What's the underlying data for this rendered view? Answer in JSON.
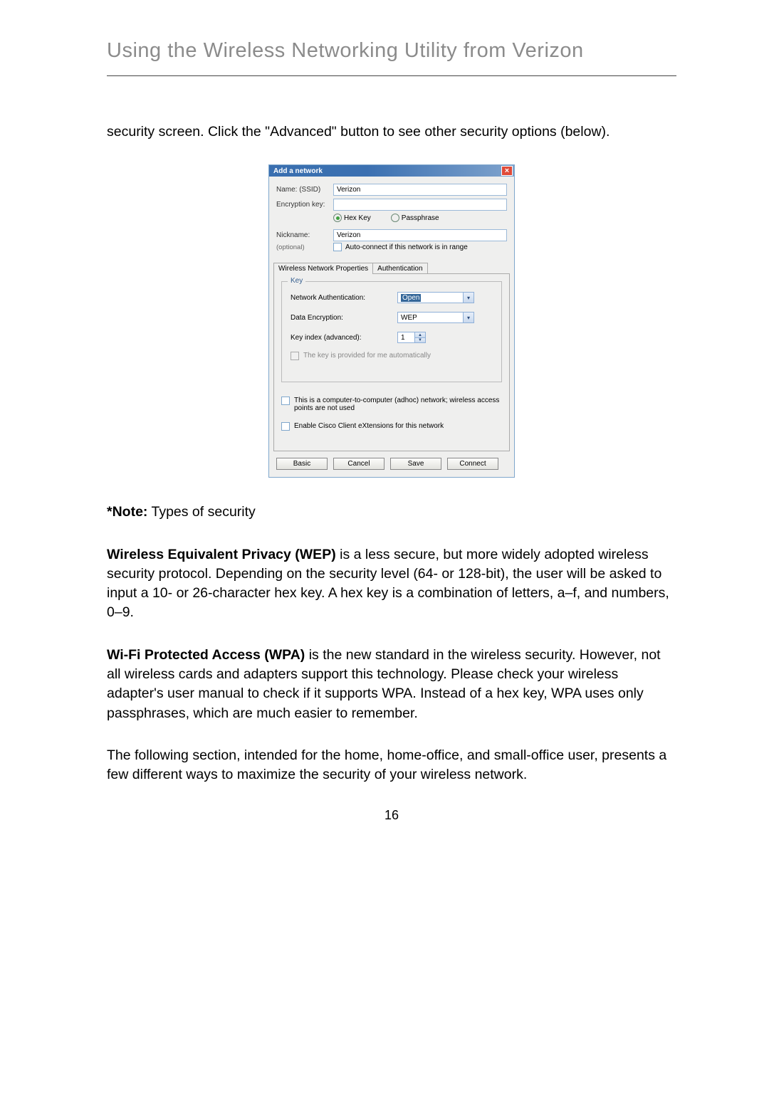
{
  "page": {
    "title": "Using the Wireless Networking Utility from Verizon",
    "intro": "security screen. Click the \"Advanced\" button to see other security options (below).",
    "note_label": "*Note:",
    "note_text": " Types of security",
    "wep": {
      "title": "Wireless Equivalent Privacy (WEP)",
      "text": " is a less secure, but more widely adopted wireless security protocol. Depending on the security level (64- or 128-bit), the user will be asked to input a 10- or 26-character hex key. A hex key is a combination of letters, a–f, and numbers, 0–9."
    },
    "wpa": {
      "title": "Wi-Fi Protected Access (WPA)",
      "text": " is the new standard in the wireless security. However, not all wireless cards and adapters support this technology. Please check your wireless adapter's user manual to check if it supports WPA. Instead of a hex key, WPA uses only passphrases, which are much easier to remember."
    },
    "follow": "The following section, intended for the home, home-office, and small-office user, presents a few different ways to maximize the security of your wireless network.",
    "number": "16"
  },
  "dialog": {
    "title": "Add a network",
    "labels": {
      "name": "Name:  (SSID)",
      "encryption_key": "Encryption key:",
      "nickname": "Nickname:",
      "optional": "(optional)"
    },
    "values": {
      "ssid": "Verizon",
      "encryption_key": "",
      "nickname": "Verizon"
    },
    "radio": {
      "hex": "Hex Key",
      "pass": "Passphrase"
    },
    "checkbox_autoconnect": "Auto-connect if this network is in range",
    "tabs": {
      "props": "Wireless Network Properties",
      "auth": "Authentication"
    },
    "key_section": {
      "legend": "Key",
      "net_auth_label": "Network Authentication:",
      "net_auth_value": "Open",
      "data_enc_label": "Data Encryption:",
      "data_enc_value": "WEP",
      "key_index_label": "Key index (advanced):",
      "key_index_value": "1",
      "auto_key": "The key is provided for me automatically"
    },
    "adhoc": "This is a computer-to-computer (adhoc) network; wireless access points are not used",
    "cisco": "Enable Cisco Client eXtensions for this network",
    "buttons": {
      "basic": "Basic",
      "cancel": "Cancel",
      "save": "Save",
      "connect": "Connect"
    }
  }
}
